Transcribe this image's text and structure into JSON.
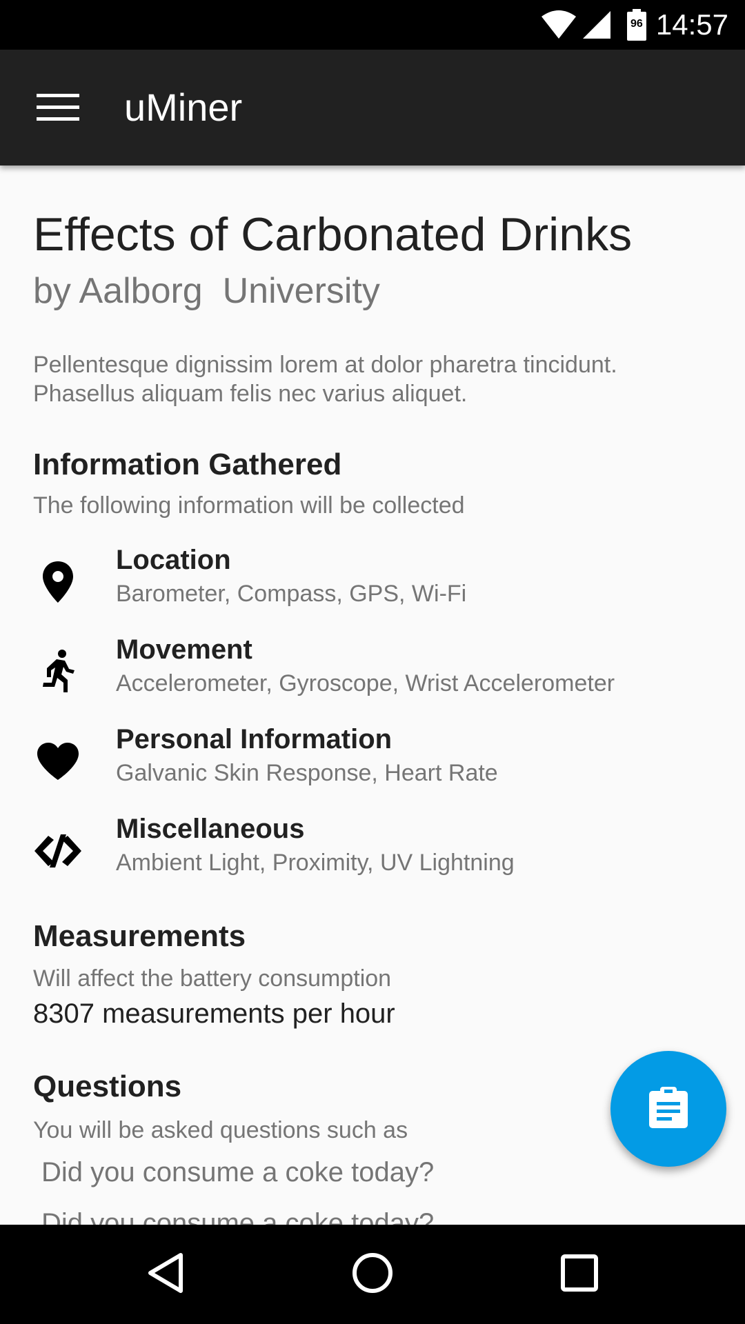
{
  "status_bar": {
    "battery_level": "96",
    "time": "14:57",
    "icons": [
      "wifi-icon",
      "cell-signal-icon",
      "battery-icon"
    ]
  },
  "app_bar": {
    "title": "uMiner",
    "menu_icon": "hamburger-menu-icon"
  },
  "study": {
    "title": "Effects of Carbonated Drinks",
    "organization": "by Aalborg  University",
    "description": "Pellentesque dignissim lorem at dolor pharetra tincidunt. Phasellus aliquam felis nec varius aliquet."
  },
  "information_gathered": {
    "heading": "Information Gathered",
    "subheading": "The following information will be collected",
    "items": [
      {
        "icon": "location-pin-icon",
        "title": "Location",
        "detail": "Barometer, Compass, GPS, Wi-Fi"
      },
      {
        "icon": "running-person-icon",
        "title": "Movement",
        "detail": "Accelerometer, Gyroscope, Wrist Accelerometer"
      },
      {
        "icon": "heart-icon",
        "title": "Personal Information",
        "detail": "Galvanic Skin Response, Heart Rate"
      },
      {
        "icon": "code-tags-icon",
        "title": "Miscellaneous",
        "detail": "Ambient Light, Proximity, UV Lightning"
      }
    ]
  },
  "measurements": {
    "heading": "Measurements",
    "subheading": "Will affect the battery consumption",
    "value": "8307 measurements per hour"
  },
  "questions": {
    "heading": "Questions",
    "subheading": "You will be asked questions such as",
    "items": [
      "Did you consume a coke today?",
      "Did you consume a coke today?"
    ]
  },
  "fab": {
    "icon": "clipboard-icon"
  },
  "nav_bar": {
    "icons": [
      "back-icon",
      "home-icon",
      "recents-icon"
    ]
  },
  "colors": {
    "app_bar": "#212121",
    "fab": "#039be5",
    "background": "#fafafa",
    "secondary_text": "#757575"
  }
}
